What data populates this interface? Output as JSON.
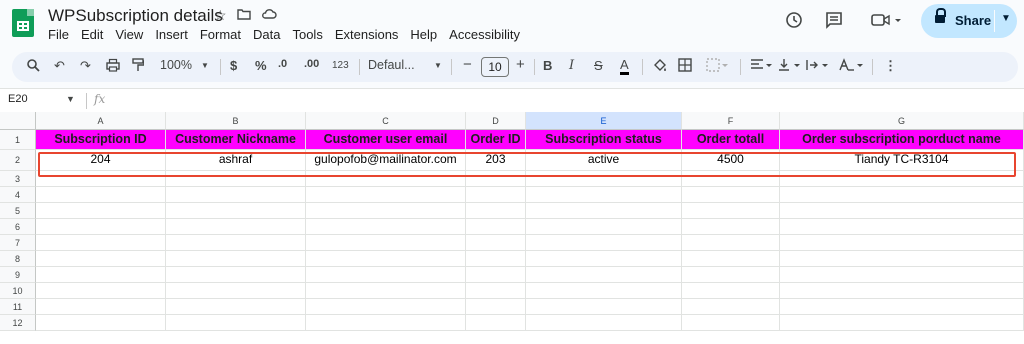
{
  "app": {
    "doc_title": "WPSubscription details",
    "menu": [
      "File",
      "Edit",
      "View",
      "Insert",
      "Format",
      "Data",
      "Tools",
      "Extensions",
      "Help",
      "Accessibility"
    ],
    "share_label": "Share"
  },
  "toolbar": {
    "zoom": "100%",
    "currency": "$",
    "percent": "%",
    "dec_decrease": ".0",
    "dec_increase": ".00",
    "number_format": "123",
    "font": "Defaul...",
    "font_size": "10",
    "bold": "B",
    "italic": "I",
    "strike": "S",
    "text_color": "A",
    "minus": "−",
    "plus": "+"
  },
  "formula_bar": {
    "cell_ref": "E20",
    "fx": "fx"
  },
  "sheet": {
    "columns": [
      "A",
      "B",
      "C",
      "D",
      "E",
      "F",
      "G"
    ],
    "selected_column": "E",
    "row_numbers": [
      "1",
      "2",
      "3",
      "4",
      "5",
      "6",
      "7",
      "8",
      "9",
      "10",
      "11",
      "12"
    ],
    "header_row": [
      "Subscription ID",
      "Customer Nickname",
      "Customer user email",
      "Order ID",
      "Subscription status",
      "Order totall",
      "Order subscription porduct name"
    ],
    "data_rows": [
      [
        "204",
        "ashraf",
        "gulopofob@mailinator.com",
        "203",
        "active",
        "4500",
        "Tiandy TC-R3104"
      ]
    ],
    "header_bg": "#ff00ff",
    "highlight_color": "#e8452f"
  }
}
